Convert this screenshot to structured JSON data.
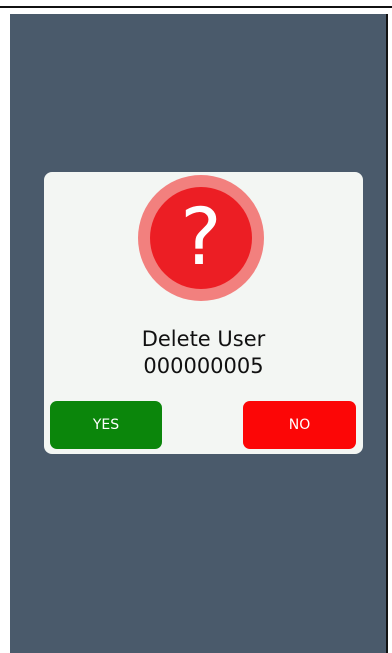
{
  "dialog": {
    "icon": "question-mark-icon",
    "icon_glyph": "?",
    "title": "Delete User",
    "user_id": "000000005",
    "yes_label": "YES",
    "no_label": "NO"
  },
  "colors": {
    "background": "#4a5a6b",
    "dialog": "#f3f6f3",
    "icon_outer": "#f2807e",
    "icon_inner": "#ec1e24",
    "yes": "#0b860b",
    "no": "#fc0606"
  }
}
